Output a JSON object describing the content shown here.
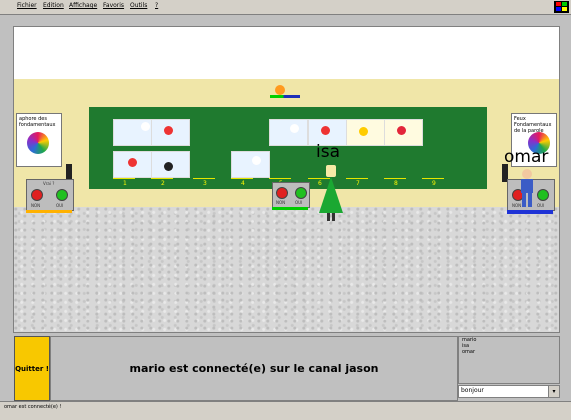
{
  "menu": [
    "Fichier",
    "Edition",
    "Affichage",
    "Favoris",
    "Outils",
    "?"
  ],
  "scene": {
    "avatars": [
      {
        "name": "isa"
      },
      {
        "name": "omar"
      }
    ],
    "board_slots": [
      "1",
      "2",
      "3",
      "4",
      "5",
      "6",
      "7",
      "8",
      "9"
    ],
    "panels": [
      {
        "left_label": "NON",
        "right_label": "OUI",
        "head": "Vrai ?"
      },
      {
        "left_label": "NON",
        "right_label": "OUI"
      },
      {
        "left_label": "NON",
        "right_label": "OUI",
        "head": "?"
      }
    ],
    "posters": [
      {
        "text": "aphore des fondamentaux"
      },
      {
        "text": "Feux Fondamentaux de la parole"
      }
    ]
  },
  "buttons": {
    "quit_label": "Quitter !"
  },
  "message": "mario est connecté(e) sur le canal jason",
  "users": [
    "mario",
    "isa",
    "omar"
  ],
  "chat_input_value": "bonjour",
  "status_text": "omar  est connecté(e) !",
  "colors": {
    "accent": "#f8c800",
    "board": "#1f7a2f",
    "wall": "#f0e6a8"
  }
}
